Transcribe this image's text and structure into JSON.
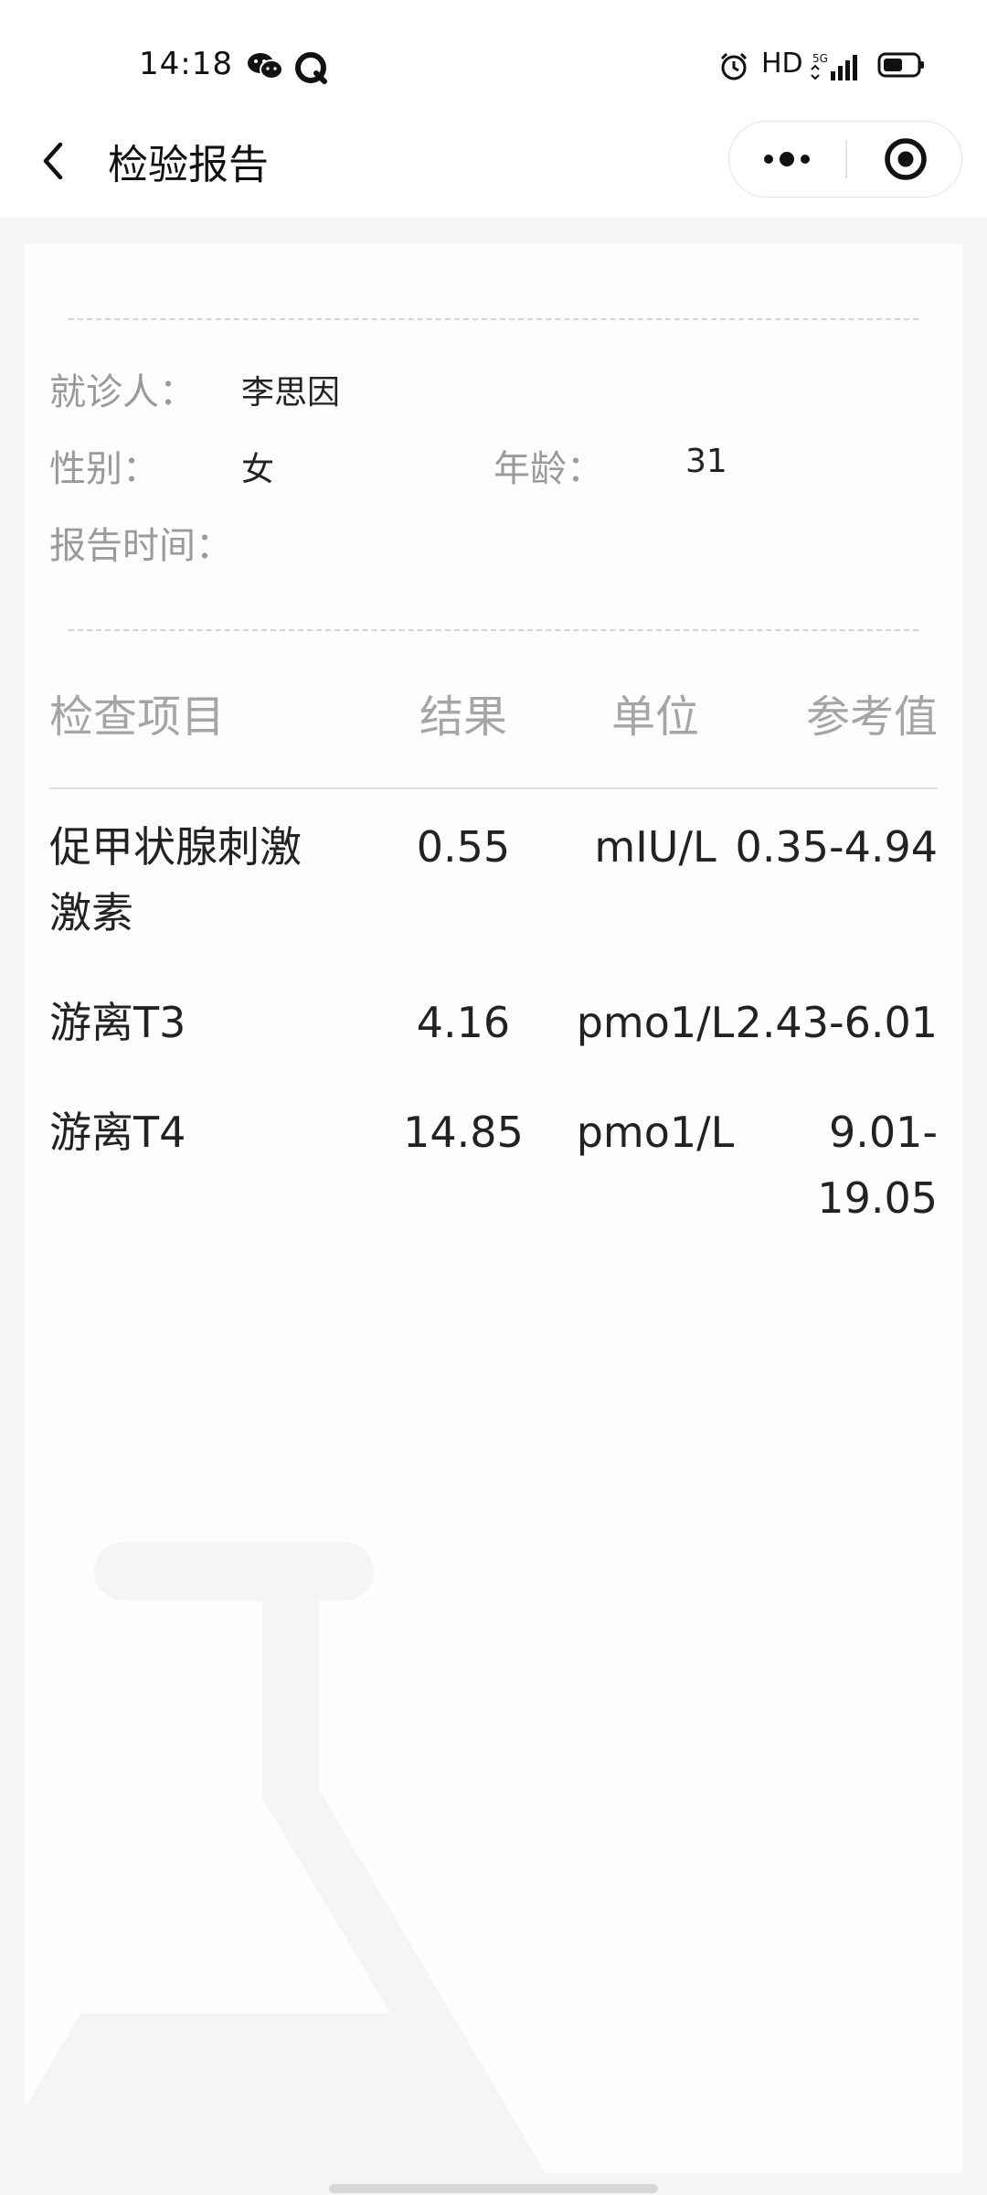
{
  "status_bar": {
    "time": "14:18",
    "hd": "HD",
    "network": "5G"
  },
  "nav": {
    "title": "检验报告"
  },
  "patient": {
    "name_label": "就诊人：",
    "name": "李思因",
    "gender_label": "性别：",
    "gender": "女",
    "age_label": "年龄：",
    "age": "31",
    "report_time_label": "报告时间：",
    "report_time": ""
  },
  "table": {
    "headers": [
      "检查项目",
      "结果",
      "单位",
      "参考值"
    ],
    "rows": [
      {
        "item_line1": "促甲状腺刺激",
        "item_line2": "激素",
        "result": "0.55",
        "unit": "mIU/L",
        "ref_line1": "0.35-4.94",
        "ref_line2": ""
      },
      {
        "item_line1": "游离T3",
        "item_line2": "",
        "result": "4.16",
        "unit": "pmo1/L",
        "ref_line1": "2.43-6.01",
        "ref_line2": ""
      },
      {
        "item_line1": "游离T4",
        "item_line2": "",
        "result": "14.85",
        "unit": "pmo1/L",
        "ref_line1": "9.01-",
        "ref_line2": "19.05"
      }
    ]
  },
  "colors": {
    "label": "#9a9a9a",
    "text": "#222222",
    "background": "#f5f5f5",
    "card": "#fdfdfd"
  },
  "icons": {
    "back": "chevron-left-icon",
    "menu": "more-dots-icon",
    "close": "target-circle-icon",
    "watermark": "flask-icon"
  }
}
